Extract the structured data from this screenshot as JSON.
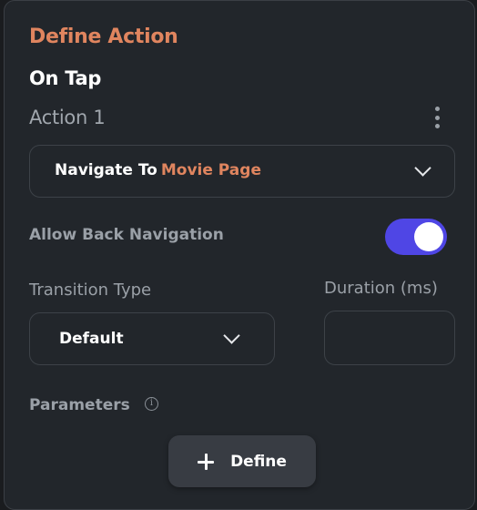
{
  "panel": {
    "title": "Define Action",
    "trigger": "On Tap",
    "action_label": "Action 1"
  },
  "navigate": {
    "prefix": "Navigate To",
    "target": "Movie Page"
  },
  "back_navigation": {
    "label": "Allow Back Navigation",
    "enabled": true
  },
  "transition": {
    "label": "Transition Type",
    "value": "Default"
  },
  "duration": {
    "label": "Duration (ms)",
    "value": ""
  },
  "parameters": {
    "label": "Parameters",
    "define_label": "Define"
  },
  "colors": {
    "accent": "#e0855f",
    "toggle_on": "#4f46e5",
    "panel_bg": "#22262b"
  },
  "icons": {
    "more": "more-vertical-icon",
    "dropdown": "chevron-down-icon",
    "info": "info-icon",
    "add": "plus-icon"
  }
}
